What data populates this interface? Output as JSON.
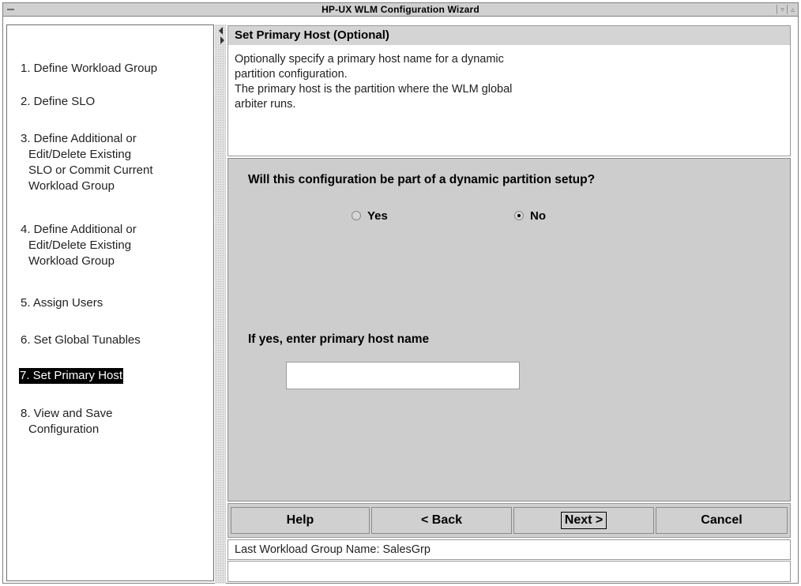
{
  "window": {
    "title": "HP-UX WLM Configuration Wizard",
    "minimize_glyph": "▿",
    "maximize_glyph": "▵"
  },
  "steps": [
    {
      "lines": [
        "1. Define Workload Group"
      ],
      "selected": false
    },
    {
      "lines": [
        "2. Define SLO"
      ],
      "selected": false
    },
    {
      "lines": [
        "3. Define Additional or",
        "Edit/Delete Existing",
        "SLO or Commit Current",
        "Workload Group"
      ],
      "selected": false
    },
    {
      "lines": [
        "4. Define Additional or",
        "Edit/Delete Existing",
        "Workload Group"
      ],
      "selected": false
    },
    {
      "lines": [
        "5. Assign Users"
      ],
      "selected": false
    },
    {
      "lines": [
        "6. Set Global Tunables"
      ],
      "selected": false
    },
    {
      "lines": [
        "7. Set Primary Host"
      ],
      "selected": true
    },
    {
      "lines": [
        "8. View and Save",
        "Configuration"
      ],
      "selected": false
    }
  ],
  "header": {
    "title": "Set Primary Host (Optional)",
    "description_lines": [
      "Optionally specify a primary host name for a dynamic",
      "partition configuration.",
      "The primary host is the partition where the WLM global",
      "arbiter runs."
    ]
  },
  "form": {
    "question": "Will this configuration be part of a dynamic partition setup?",
    "options": [
      {
        "label": "Yes",
        "selected": false
      },
      {
        "label": "No",
        "selected": true
      }
    ],
    "host_label": "If yes, enter primary host name",
    "host_value": ""
  },
  "buttons": {
    "help": "Help",
    "back": "< Back",
    "next": "Next >",
    "cancel": "Cancel"
  },
  "status": {
    "text": "Last Workload Group Name: SalesGrp"
  }
}
